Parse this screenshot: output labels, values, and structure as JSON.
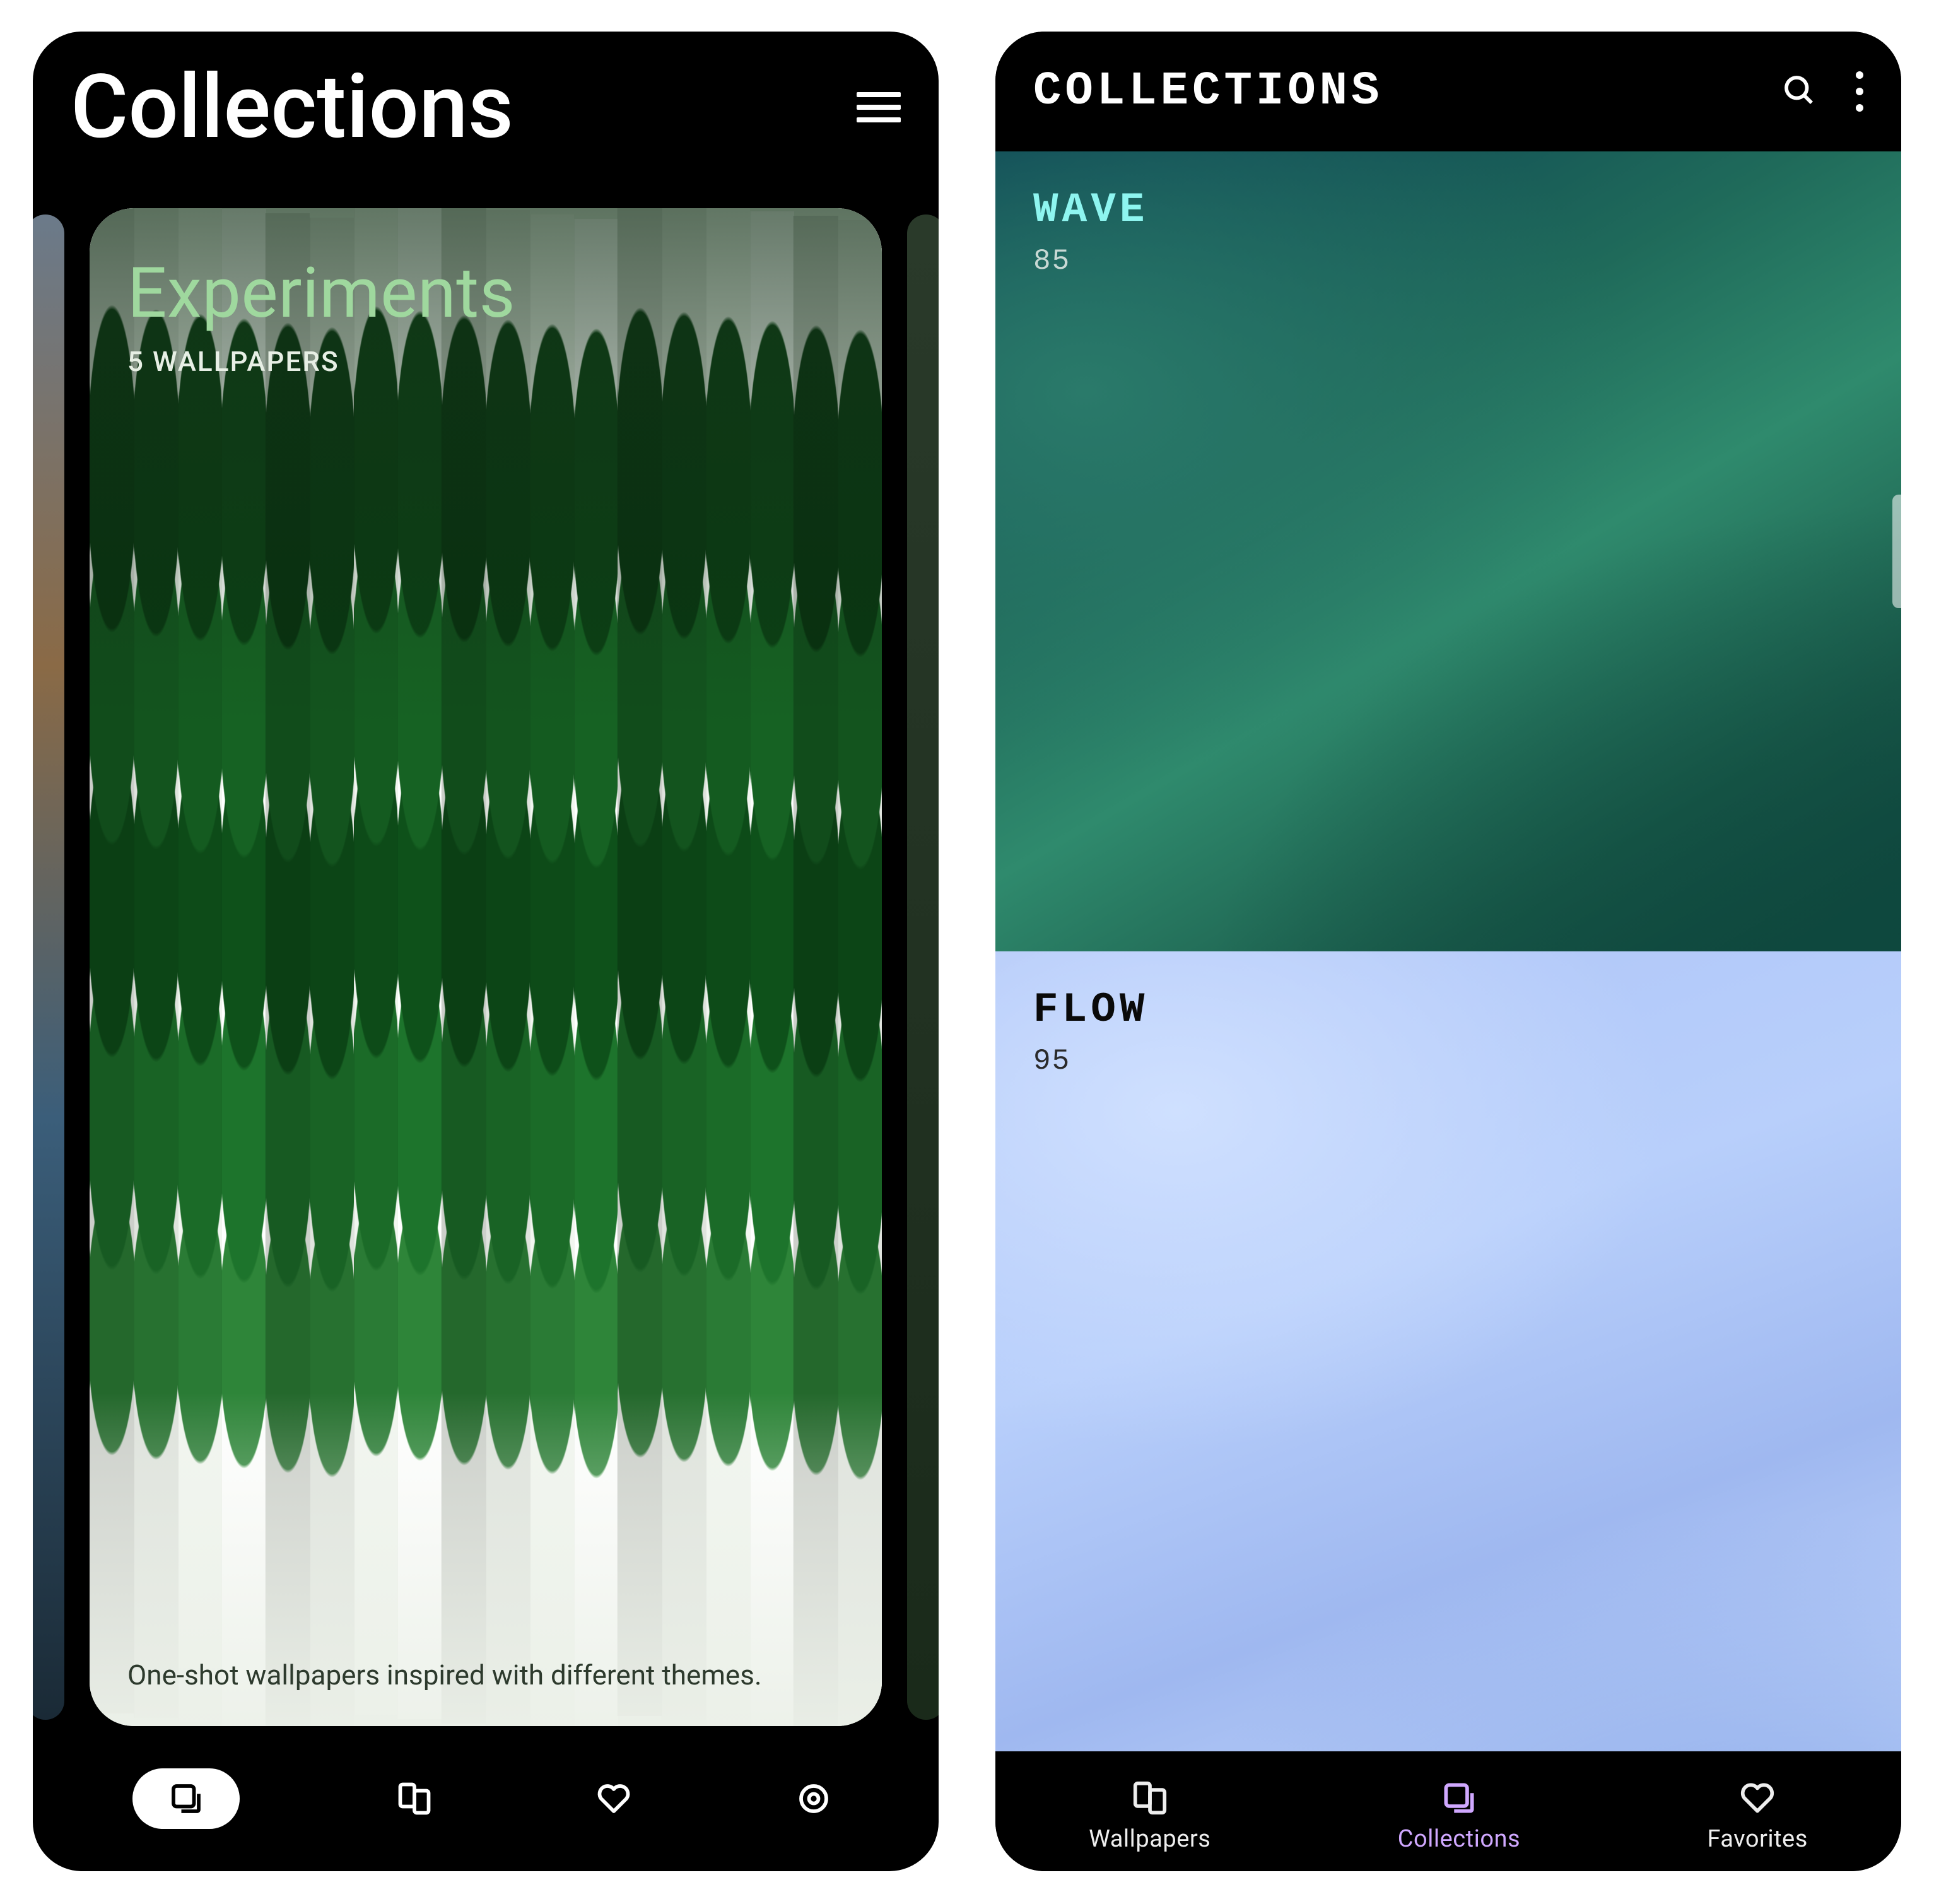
{
  "left": {
    "title": "Collections",
    "card": {
      "name": "Experiments",
      "subtitle": "5 WALLPAPERS",
      "description": "One-shot wallpapers inspired with different themes."
    },
    "nav": {
      "active": "collections",
      "items": [
        "collections",
        "wallpapers",
        "favorites",
        "settings"
      ]
    }
  },
  "right": {
    "title": "COLLECTIONS",
    "collections": [
      {
        "id": "wave",
        "name": "WAVE",
        "count": "85",
        "accent": "#8ef5f0"
      },
      {
        "id": "flow",
        "name": "FLOW",
        "count": "95",
        "accent": "#0a0a0a"
      }
    ],
    "tabs": [
      {
        "id": "wallpapers",
        "label": "Wallpapers"
      },
      {
        "id": "collections",
        "label": "Collections"
      },
      {
        "id": "favorites",
        "label": "Favorites"
      }
    ],
    "activeTab": "collections"
  }
}
